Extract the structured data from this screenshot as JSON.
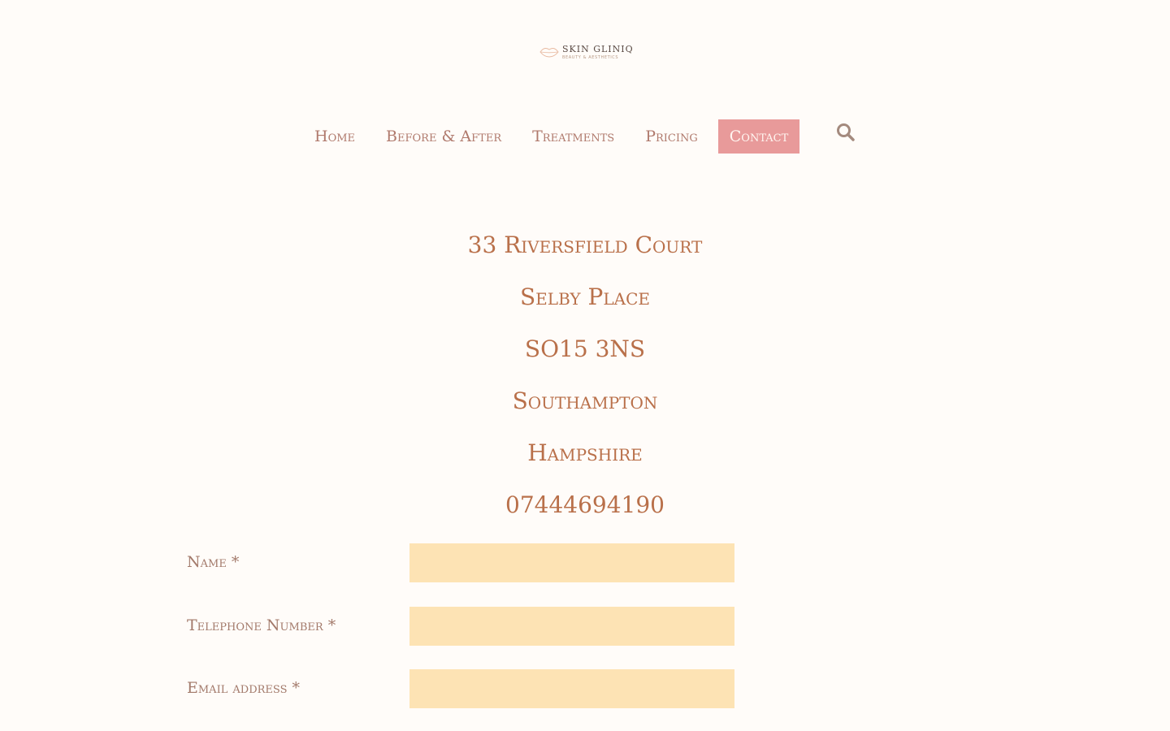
{
  "brand": {
    "name": "SKIN GLINIQ",
    "tagline": "BEAUTY & AESTHETICS"
  },
  "nav": {
    "items": [
      {
        "label": "Home"
      },
      {
        "label": "Before & After"
      },
      {
        "label": "Treatments"
      },
      {
        "label": "Pricing"
      },
      {
        "label": "Contact",
        "active": true
      }
    ],
    "search_icon": "search-icon"
  },
  "address": {
    "lines": [
      "33 Riversfield Court",
      "Selby Place",
      "SO15 3NS",
      "Southampton",
      "Hampshire",
      "07444694190"
    ]
  },
  "form": {
    "fields": [
      {
        "label": "Name *",
        "value": ""
      },
      {
        "label": "Telephone Number *",
        "value": ""
      },
      {
        "label": "Email address *",
        "value": ""
      }
    ]
  },
  "colors": {
    "background": "#fffcf9",
    "nav_text": "#b07a6d",
    "nav_active_bg": "#e89a9a",
    "address_text": "#b9704a",
    "input_bg": "#fde3b4"
  }
}
